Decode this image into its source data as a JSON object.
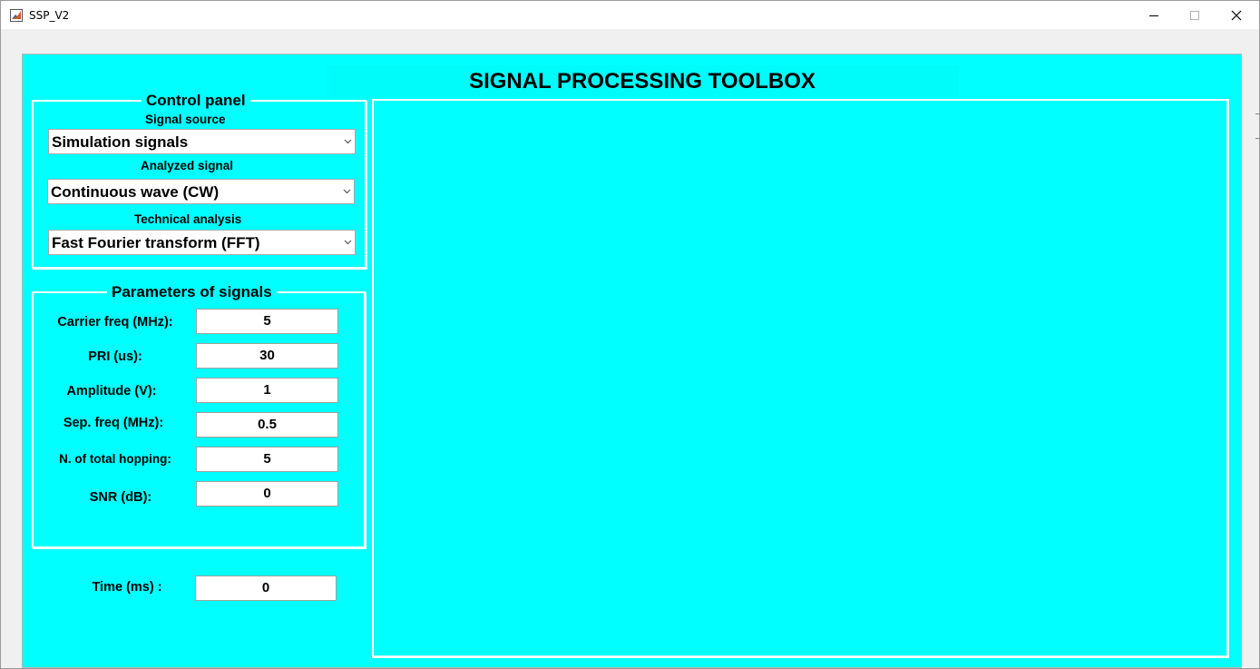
{
  "window": {
    "title": "SSP_V2",
    "minimize_glyph": "—",
    "maximize_glyph": "☐",
    "close_glyph": "✕"
  },
  "header": {
    "title": "SIGNAL PROCESSING TOOLBOX"
  },
  "control_panel": {
    "title": "Control panel",
    "signal_source_label": "Signal source",
    "signal_source_value": "Simulation signals",
    "analyzed_signal_label": "Analyzed signal",
    "analyzed_signal_value": "Continuous wave (CW)",
    "technical_analysis_label": "Technical analysis",
    "technical_analysis_value": "Fast Fourier transform (FFT)"
  },
  "parameters": {
    "title": "Parameters of signals",
    "fields": [
      {
        "label": "Carrier freq (MHz):",
        "value": "5"
      },
      {
        "label": "PRI (us):",
        "value": "30"
      },
      {
        "label": "Amplitude (V):",
        "value": "1"
      },
      {
        "label": "Sep.  freq (MHz):",
        "value": "0.5"
      },
      {
        "label": "N. of total hopping:",
        "value": "5"
      },
      {
        "label": "SNR (dB):",
        "value": "0"
      }
    ]
  },
  "time": {
    "label": "Time (ms) :",
    "value": "0"
  },
  "colors": {
    "figure_background": "#00ffff",
    "panel_border": "#ffffff"
  },
  "icons": {
    "app": "matlab-icon",
    "dropdown": "chevron-down-icon"
  }
}
